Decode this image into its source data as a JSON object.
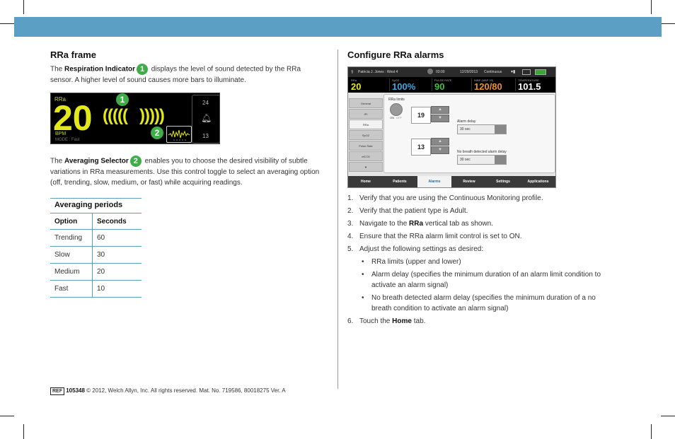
{
  "left": {
    "heading": "RRa frame",
    "p1_pre": "The ",
    "p1_bold": "Respiration Indicator",
    "p1_callout": "1",
    "p1_post": " displays the level of sound detected by the RRa sensor. A higher level of sound causes more bars to illuminate.",
    "p2_pre": "The ",
    "p2_bold": "Averaging Selector",
    "p2_callout": "2",
    "p2_post": " enables you to choose the desired visibility of subtle variations in RRa measurements. Use this control toggle to select an averaging option (off, trending, slow, medium, or fast) while acquiring readings."
  },
  "rra_frame": {
    "label": "RRa",
    "value": "20",
    "unit": "BPM",
    "mode": "MODE : Fast",
    "upper_limit": "24",
    "lower_limit": "13",
    "callout_1": "1",
    "callout_2": "2"
  },
  "table": {
    "caption": "Averaging periods",
    "headers": [
      "Option",
      "Seconds"
    ],
    "rows": [
      [
        "Trending",
        "60"
      ],
      [
        "Slow",
        "30"
      ],
      [
        "Medium",
        "20"
      ],
      [
        "Fast",
        "10"
      ]
    ]
  },
  "right": {
    "heading": "Configure RRa alarms"
  },
  "device": {
    "patient": "Patricia J. Jones : West 4",
    "time": "03:00",
    "date": "12/29/2013",
    "profile": "Continuous",
    "vitals": [
      {
        "title": "RRa",
        "value": "20",
        "color": "#e3e81a"
      },
      {
        "title": "SpO2",
        "value": "100%",
        "color": "#38a8e8"
      },
      {
        "title": "PULSE RATE",
        "value": "90",
        "color": "#3ec23e"
      },
      {
        "title": "NIBP (MAP 93)",
        "value": "120/80",
        "color": "#f09020"
      },
      {
        "title": "TEMPERATURE",
        "value": "101.5",
        "color": "#ffffff"
      }
    ],
    "vtabs": [
      "General",
      "IPI",
      "RRa",
      "SpO2",
      "Pulse Rate",
      "etCO2"
    ],
    "rra_limits_label": "RRa limits",
    "toggle_on": "ON",
    "toggle_off": "OFF",
    "upper_limit": "19",
    "lower_limit": "13",
    "alarm_delay_label": "Alarm delay",
    "alarm_delay_value": "30 sec",
    "no_breath_label": "No breath detected alarm delay",
    "no_breath_value": "30 sec",
    "btabs": [
      "Home",
      "Patients",
      "Alarms",
      "Review",
      "Settings",
      "Applications"
    ]
  },
  "steps": {
    "s1": "Verify that you are using the Continuous Monitoring profile.",
    "s2": "Verify that the patient type is Adult.",
    "s3_pre": "Navigate to the ",
    "s3_bold": "RRa",
    "s3_post": " vertical tab as shown.",
    "s4": "Ensure that the RRa alarm limit control is set to ON.",
    "s5": "Adjust the following settings as desired:",
    "b1": "RRa limits (upper and lower)",
    "b2": "Alarm delay (specifies the minimum duration of an alarm limit condition to activate an alarm signal)",
    "b3": "No breath detected alarm delay (specifies the minimum duration of a no breath condition to activate an alarm signal)",
    "s6_pre": "Touch the ",
    "s6_bold": "Home",
    "s6_post": " tab.",
    "n1": "1.",
    "n2": "2.",
    "n3": "3.",
    "n4": "4.",
    "n5": "5.",
    "n6": "6.",
    "bullet": "•"
  },
  "footer": {
    "ref": "REF",
    "number": "105348",
    "text": "© 2012, Welch Allyn, Inc. All rights reserved. Mat. No. 719586, 80018275 Ver. A"
  },
  "colors": {
    "topbar": "#5b9fc4",
    "callout": "#3fae49"
  }
}
